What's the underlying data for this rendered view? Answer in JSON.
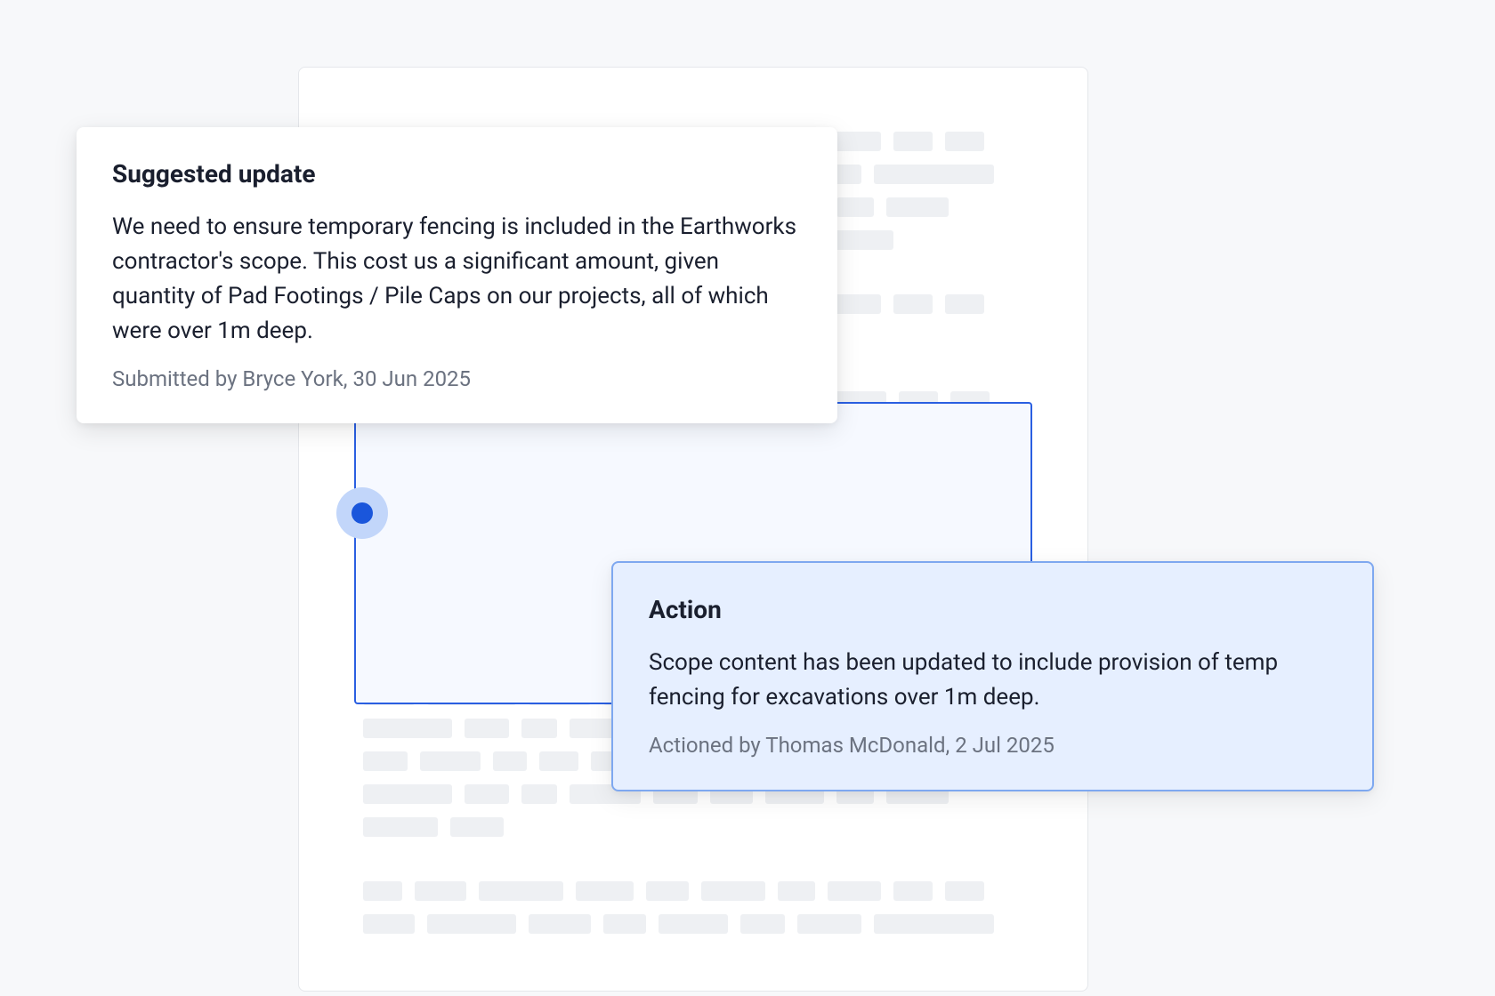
{
  "suggested_update": {
    "title": "Suggested update",
    "body": "We need to ensure temporary fencing is included in the Earthworks contractor's scope. This cost us a significant amount, given quantity of Pad Footings / Pile Caps on our projects, all of which were over 1m deep.",
    "meta": "Submitted by Bryce York, 30 Jun 2025"
  },
  "action": {
    "title": "Action",
    "body": "Scope content has been updated to include provision of temp fencing for excavations over 1m deep.",
    "meta": "Actioned by Thomas McDonald, 2 Jul 2025"
  }
}
